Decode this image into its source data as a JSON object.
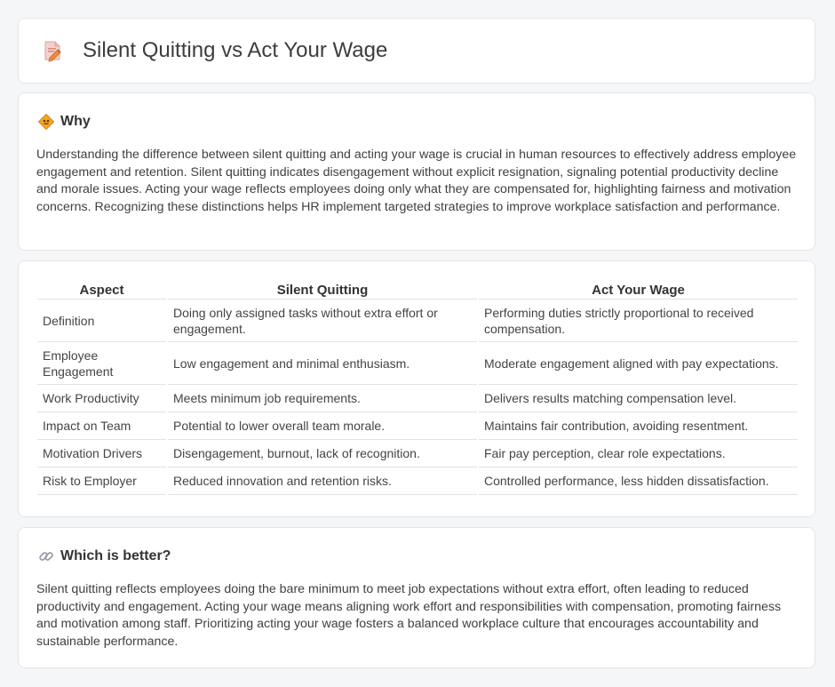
{
  "header": {
    "title": "Silent Quitting vs Act Your Wage",
    "icon": "pencil-paper-icon"
  },
  "why": {
    "icon": "diamond-sign-icon",
    "title": "Why",
    "body": "Understanding the difference between silent quitting and acting your wage is crucial in human resources to effectively address employee engagement and retention. Silent quitting indicates disengagement without explicit resignation, signaling potential productivity decline and morale issues. Acting your wage reflects employees doing only what they are compensated for, highlighting fairness and motivation concerns. Recognizing these distinctions helps HR implement targeted strategies to improve workplace satisfaction and performance."
  },
  "comparison": {
    "headers": [
      "Aspect",
      "Silent Quitting",
      "Act Your Wage"
    ],
    "rows": [
      [
        "Definition",
        "Doing only assigned tasks without extra effort or engagement.",
        "Performing duties strictly proportional to received compensation."
      ],
      [
        "Employee Engagement",
        "Low engagement and minimal enthusiasm.",
        "Moderate engagement aligned with pay expectations."
      ],
      [
        "Work Productivity",
        "Meets minimum job requirements.",
        "Delivers results matching compensation level."
      ],
      [
        "Impact on Team",
        "Potential to lower overall team morale.",
        "Maintains fair contribution, avoiding resentment."
      ],
      [
        "Motivation Drivers",
        "Disengagement, burnout, lack of recognition.",
        "Fair pay perception, clear role expectations."
      ],
      [
        "Risk to Employer",
        "Reduced innovation and retention risks.",
        "Controlled performance, less hidden dissatisfaction."
      ]
    ]
  },
  "better": {
    "icon": "link-icon",
    "title": "Which is better?",
    "body": "Silent quitting reflects employees doing the bare minimum to meet job expectations without extra effort, often leading to reduced productivity and engagement. Acting your wage means aligning work effort and responsibilities with compensation, promoting fairness and motivation among staff. Prioritizing acting your wage fosters a balanced workplace culture that encourages accountability and sustainable performance."
  }
}
